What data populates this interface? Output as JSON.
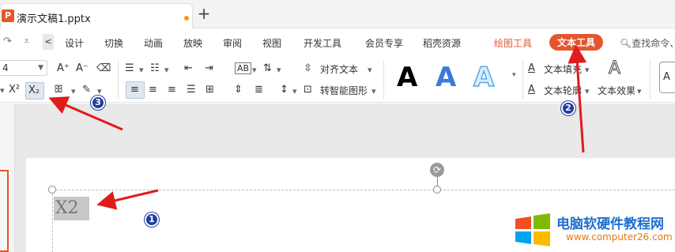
{
  "tabbar": {
    "app_icon_label": "P",
    "doc_title": "演示文稿1.pptx",
    "new_tab": "+"
  },
  "menubar": {
    "redo_icon": "redo-icon",
    "prev_arrow": "<",
    "items": [
      "设计",
      "切换",
      "动画",
      "放映",
      "审阅",
      "视图",
      "开发工具",
      "会员专享",
      "稻壳资源"
    ],
    "drawing_tools": "绘图工具",
    "text_tools": "文本工具",
    "search": "查找命令、"
  },
  "ribbon": {
    "font_size": "4",
    "grow_font": "A⁺",
    "shrink_font": "A⁻",
    "clear_format": "⌫",
    "superscript": "X²",
    "subscript": "X₂",
    "phonetic": "ꕥ",
    "eraser": "✎",
    "align_text_label": "对齐文本",
    "smart_graphic_label": "转智能图形",
    "art_letter": "A",
    "text_fill_label": "文本填充",
    "text_outline_label": "文本轮廓",
    "text_effect_label": "文本效果",
    "text_effect_icon": "A"
  },
  "canvas": {
    "selected_text": "X2"
  },
  "annotations": {
    "marker_1": "1",
    "marker_2": "2",
    "marker_3": "3"
  },
  "watermark": {
    "title": "电脑软硬件教程网",
    "url": "www.computer26.com"
  },
  "colors": {
    "accent": "#e4572e",
    "annotation_red": "#e11b1b",
    "marker_blue": "#1f3f9e"
  }
}
